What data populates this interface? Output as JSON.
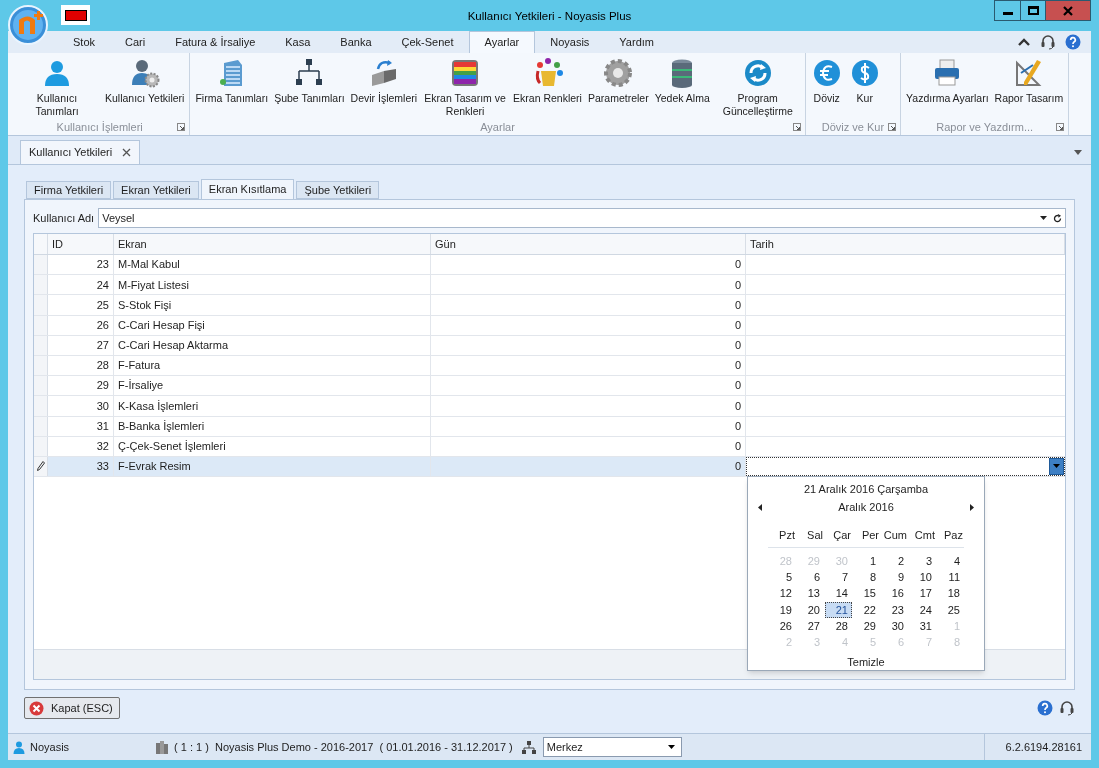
{
  "window": {
    "title": "Kullanıcı Yetkileri - Noyasis Plus"
  },
  "ribbon": {
    "tabs": [
      {
        "label": "Stok",
        "selected": false
      },
      {
        "label": "Cari",
        "selected": false
      },
      {
        "label": "Fatura & İrsaliye",
        "selected": false
      },
      {
        "label": "Kasa",
        "selected": false
      },
      {
        "label": "Banka",
        "selected": false
      },
      {
        "label": "Çek-Senet",
        "selected": false
      },
      {
        "label": "Ayarlar",
        "selected": true
      },
      {
        "label": "Noyasis",
        "selected": false
      },
      {
        "label": "Yardım",
        "selected": false
      }
    ],
    "groups": [
      {
        "label": "Kullanıcı İşlemleri",
        "buttons": [
          "Kullanıcı Tanımları",
          "Kullanıcı Yetkileri"
        ]
      },
      {
        "label": "Ayarlar",
        "buttons": [
          "Firma Tanımları",
          "Şube Tanımları",
          "Devir İşlemleri",
          "Ekran Tasarım ve Renkleri",
          "Ekran Renkleri",
          "Parametreler",
          "Yedek Alma",
          "Program Güncelleştirme"
        ]
      },
      {
        "label": "Döviz ve Kur",
        "buttons": [
          "Döviz",
          "Kur"
        ]
      },
      {
        "label": "Rapor ve Yazdırm...",
        "buttons": [
          "Yazdırma Ayarları",
          "Rapor Tasarım"
        ]
      }
    ]
  },
  "document_tabs": [
    {
      "label": "Kullanıcı Yetkileri",
      "selected": true
    }
  ],
  "inner_tabs": [
    {
      "label": "Firma Yetkileri",
      "selected": false
    },
    {
      "label": "Ekran Yetkileri",
      "selected": false
    },
    {
      "label": "Ekran Kısıtlama",
      "selected": true
    },
    {
      "label": "Şube Yetkileri",
      "selected": false
    }
  ],
  "user_field": {
    "label": "Kullanıcı Adı",
    "value": "Veysel"
  },
  "grid": {
    "columns": [
      "ID",
      "Ekran",
      "Gün",
      "Tarih"
    ],
    "rows": [
      {
        "id": "23",
        "screen": "M-Mal Kabul",
        "days": "0",
        "selected": false
      },
      {
        "id": "24",
        "screen": "M-Fiyat Listesi",
        "days": "0",
        "selected": false
      },
      {
        "id": "25",
        "screen": "S-Stok Fişi",
        "days": "0",
        "selected": false
      },
      {
        "id": "26",
        "screen": "C-Cari Hesap Fişi",
        "days": "0",
        "selected": false
      },
      {
        "id": "27",
        "screen": "C-Cari Hesap Aktarma",
        "days": "0",
        "selected": false
      },
      {
        "id": "28",
        "screen": "F-Fatura",
        "days": "0",
        "selected": false
      },
      {
        "id": "29",
        "screen": "F-İrsaliye",
        "days": "0",
        "selected": false
      },
      {
        "id": "30",
        "screen": "K-Kasa İşlemleri",
        "days": "0",
        "selected": false
      },
      {
        "id": "31",
        "screen": "B-Banka İşlemleri",
        "days": "0",
        "selected": false
      },
      {
        "id": "32",
        "screen": "Ç-Çek-Senet İşlemleri",
        "days": "0",
        "selected": false
      },
      {
        "id": "33",
        "screen": "F-Evrak Resim",
        "days": "0",
        "selected": true
      }
    ]
  },
  "calendar": {
    "today": "21 Aralık 2016 Çarşamba",
    "month": "Aralık 2016",
    "weekdays": [
      "Pzt",
      "Sal",
      "Çar",
      "Per",
      "Cum",
      "Cmt",
      "Paz"
    ],
    "weeks": [
      [
        {
          "day": "28",
          "other_month": true,
          "selected": false
        },
        {
          "day": "29",
          "other_month": true,
          "selected": false
        },
        {
          "day": "30",
          "other_month": true,
          "selected": false
        },
        {
          "day": "1",
          "other_month": false,
          "selected": false
        },
        {
          "day": "2",
          "other_month": false,
          "selected": false
        },
        {
          "day": "3",
          "other_month": false,
          "selected": false
        },
        {
          "day": "4",
          "other_month": false,
          "selected": false
        }
      ],
      [
        {
          "day": "5",
          "other_month": false,
          "selected": false
        },
        {
          "day": "6",
          "other_month": false,
          "selected": false
        },
        {
          "day": "7",
          "other_month": false,
          "selected": false
        },
        {
          "day": "8",
          "other_month": false,
          "selected": false
        },
        {
          "day": "9",
          "other_month": false,
          "selected": false
        },
        {
          "day": "10",
          "other_month": false,
          "selected": false
        },
        {
          "day": "11",
          "other_month": false,
          "selected": false
        }
      ],
      [
        {
          "day": "12",
          "other_month": false,
          "selected": false
        },
        {
          "day": "13",
          "other_month": false,
          "selected": false
        },
        {
          "day": "14",
          "other_month": false,
          "selected": false
        },
        {
          "day": "15",
          "other_month": false,
          "selected": false
        },
        {
          "day": "16",
          "other_month": false,
          "selected": false
        },
        {
          "day": "17",
          "other_month": false,
          "selected": false
        },
        {
          "day": "18",
          "other_month": false,
          "selected": false
        }
      ],
      [
        {
          "day": "19",
          "other_month": false,
          "selected": false
        },
        {
          "day": "20",
          "other_month": false,
          "selected": false
        },
        {
          "day": "21",
          "other_month": false,
          "selected": true
        },
        {
          "day": "22",
          "other_month": false,
          "selected": false
        },
        {
          "day": "23",
          "other_month": false,
          "selected": false
        },
        {
          "day": "24",
          "other_month": false,
          "selected": false
        },
        {
          "day": "25",
          "other_month": false,
          "selected": false
        }
      ],
      [
        {
          "day": "26",
          "other_month": false,
          "selected": false
        },
        {
          "day": "27",
          "other_month": false,
          "selected": false
        },
        {
          "day": "28",
          "other_month": false,
          "selected": false
        },
        {
          "day": "29",
          "other_month": false,
          "selected": false
        },
        {
          "day": "30",
          "other_month": false,
          "selected": false
        },
        {
          "day": "31",
          "other_month": false,
          "selected": false
        },
        {
          "day": "1",
          "other_month": true,
          "selected": false
        }
      ],
      [
        {
          "day": "2",
          "other_month": true,
          "selected": false
        },
        {
          "day": "3",
          "other_month": true,
          "selected": false
        },
        {
          "day": "4",
          "other_month": true,
          "selected": false
        },
        {
          "day": "5",
          "other_month": true,
          "selected": false
        },
        {
          "day": "6",
          "other_month": true,
          "selected": false
        },
        {
          "day": "7",
          "other_month": true,
          "selected": false
        },
        {
          "day": "8",
          "other_month": true,
          "selected": false
        }
      ]
    ],
    "clear": "Temizle"
  },
  "close_button": "Kapat (ESC)",
  "status_bar": {
    "user": "Noyasis",
    "company": "( 1 : 1 )  Noyasis Plus Demo - 2016-2017  ( 01.01.2016 - 31.12.2017 )",
    "branch": "Merkez",
    "version": "6.2.6194.28161"
  }
}
